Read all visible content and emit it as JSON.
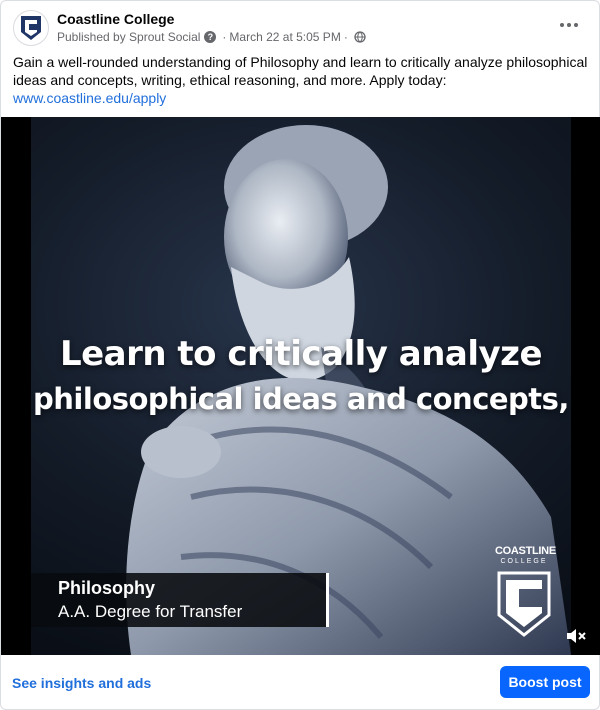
{
  "post": {
    "page_name": "Coastline College",
    "published_by": "Published by Sprout Social",
    "timestamp": "March 22 at 5:05 PM",
    "text": "Gain a well-rounded understanding of Philosophy and learn to critically analyze philosophical ideas and concepts, writing, ethical reasoning, and more. Apply today:",
    "link": "www.coastline.edu/apply"
  },
  "media": {
    "overlay_line1": "Learn to critically analyze",
    "overlay_line2": "philosophical ideas and concepts,",
    "lower_third_title": "Philosophy",
    "lower_third_subtitle": "A.A. Degree for Transfer",
    "brand_name": "COASTLINE",
    "brand_sub": "COLLEGE"
  },
  "footer": {
    "insights_label": "See insights and ads",
    "boost_label": "Boost post"
  },
  "icons": {
    "avatar": "coastline-shield-logo",
    "info": "question-mark-icon",
    "audience": "globe-icon",
    "more": "ellipsis-icon",
    "mute": "speaker-muted-icon"
  },
  "colors": {
    "link": "#216fdb",
    "boost_button": "#0866ff",
    "brand_navy": "#1f3566"
  }
}
